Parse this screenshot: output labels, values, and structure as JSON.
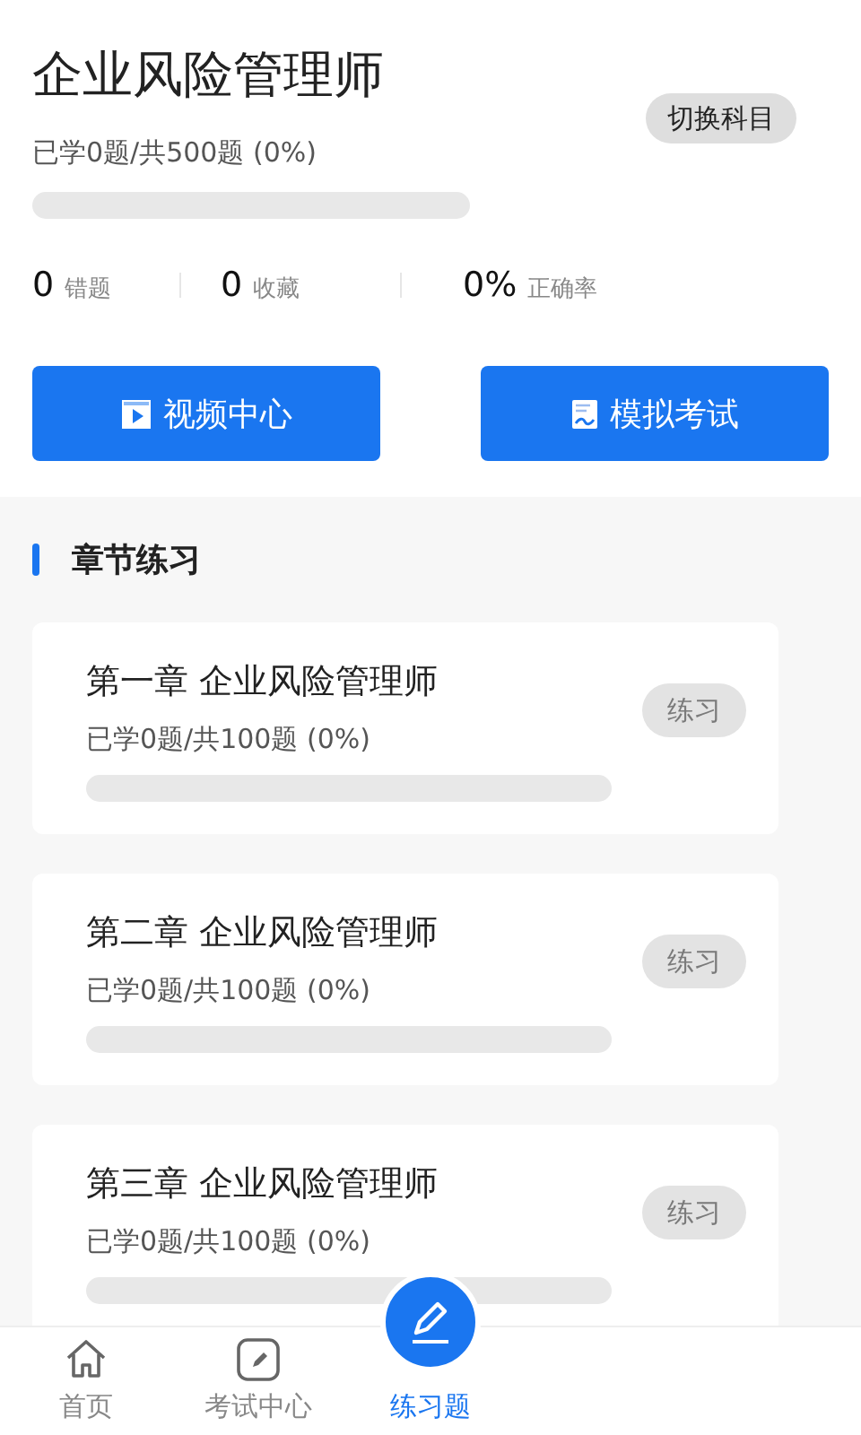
{
  "header": {
    "title": "企业风险管理师",
    "switch_button": "切换科目",
    "progress_text": "已学0题/共500题 (0%)",
    "level": 0
  },
  "stats": [
    {
      "value": "0",
      "label": "错题"
    },
    {
      "value": "0",
      "label": "收藏"
    },
    {
      "value": "0%",
      "label": "正确率"
    }
  ],
  "actions": [
    {
      "kind": "video",
      "label": "视频中心"
    },
    {
      "kind": "exam",
      "label": "模拟考试"
    }
  ],
  "section_title": "章节练习",
  "chapters": [
    {
      "title": "第一章 企业风险管理师",
      "progress_text": "已学0题/共100题 (0%)",
      "level": 0,
      "button": "练习",
      "disabled": true
    },
    {
      "title": "第二章 企业风险管理师",
      "progress_text": "已学0题/共100题 (0%)",
      "level": 0,
      "button": "练习",
      "disabled": true
    },
    {
      "title": "第三章 企业风险管理师",
      "progress_text": "已学0题/共100题 (0%)",
      "level": 0,
      "button": "练习",
      "disabled": true
    }
  ],
  "tabs": [
    {
      "kind": "home",
      "label": "首页",
      "selected": false
    },
    {
      "kind": "exam",
      "label": "考试中心",
      "selected": false
    },
    {
      "kind": "practice",
      "label": "练习题",
      "selected": true
    }
  ]
}
